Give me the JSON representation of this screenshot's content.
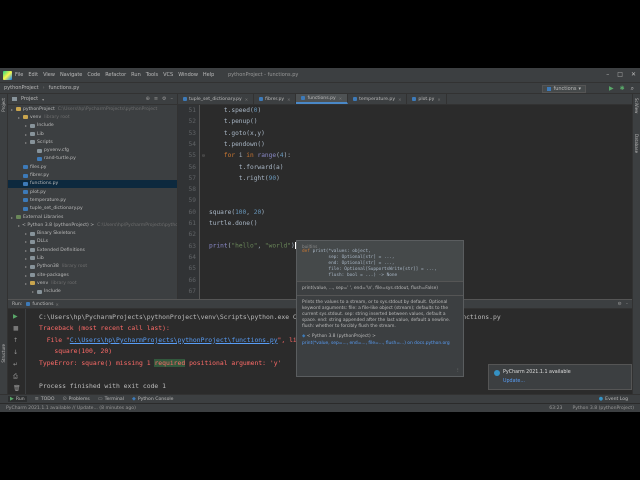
{
  "menubar": {
    "items": [
      "File",
      "Edit",
      "View",
      "Navigate",
      "Code",
      "Refactor",
      "Run",
      "Tools",
      "VCS",
      "Window",
      "Help"
    ],
    "window_title": "pythonProject - functions.py"
  },
  "navbar": {
    "crumbs": [
      "pythonProject",
      "functions.py"
    ],
    "run_config": "functions"
  },
  "project_panel": {
    "title": "Project",
    "tree": [
      {
        "label": "pythonProject",
        "hint": "C:\\Users\\hp\\PycharmProjects\\pythonProject",
        "depth": 0,
        "icon": "folder-y"
      },
      {
        "label": "venv",
        "hint": "library root",
        "depth": 1,
        "icon": "folder-y"
      },
      {
        "label": "Include",
        "hint": "",
        "depth": 2,
        "icon": "folder"
      },
      {
        "label": "Lib",
        "hint": "",
        "depth": 2,
        "icon": "folder"
      },
      {
        "label": "Scripts",
        "hint": "",
        "depth": 2,
        "icon": "folder"
      },
      {
        "label": "pyvenv.cfg",
        "hint": "",
        "depth": 3,
        "icon": "folder"
      },
      {
        "label": "rand-turtle.py",
        "hint": "",
        "depth": 3,
        "icon": "py"
      },
      {
        "label": "files.py",
        "hint": "",
        "depth": 1,
        "icon": "py"
      },
      {
        "label": "fibrer.py",
        "hint": "",
        "depth": 1,
        "icon": "py"
      },
      {
        "label": "functions.py",
        "hint": "",
        "depth": 1,
        "icon": "py"
      },
      {
        "label": "plot.py",
        "hint": "",
        "depth": 1,
        "icon": "py"
      },
      {
        "label": "temperature.py",
        "hint": "",
        "depth": 1,
        "icon": "py"
      },
      {
        "label": "tuple_set_dictionary.py",
        "hint": "",
        "depth": 1,
        "icon": "py"
      },
      {
        "label": "External Libraries",
        "hint": "",
        "depth": 0,
        "icon": "lib"
      },
      {
        "label": "< Python 3.8 (pythonProject) >",
        "hint": "C:\\Users\\hp\\PycharmProjects\\pytho",
        "depth": 1,
        "icon": "lib"
      },
      {
        "label": "Binary Skeletons",
        "hint": "",
        "depth": 2,
        "icon": "folder"
      },
      {
        "label": "DLLs",
        "hint": "",
        "depth": 2,
        "icon": "folder"
      },
      {
        "label": "Extended Definitions",
        "hint": "",
        "depth": 2,
        "icon": "folder"
      },
      {
        "label": "Lib",
        "hint": "",
        "depth": 2,
        "icon": "folder"
      },
      {
        "label": "Python38",
        "hint": "library root",
        "depth": 2,
        "icon": "folder"
      },
      {
        "label": "site-packages",
        "hint": "",
        "depth": 2,
        "icon": "folder"
      },
      {
        "label": "venv",
        "hint": "library root",
        "depth": 2,
        "icon": "folder-y"
      },
      {
        "label": "Include",
        "hint": "",
        "depth": 3,
        "icon": "folder"
      }
    ]
  },
  "editor_tabs": [
    {
      "label": "tuple_set_dictionary.py",
      "active": false
    },
    {
      "label": "fibrer.py",
      "active": false
    },
    {
      "label": "functions.py",
      "active": true
    },
    {
      "label": "temperature.py",
      "active": false
    },
    {
      "label": "plot.py",
      "active": false
    }
  ],
  "code_lines": [
    {
      "n": "51",
      "text": "    t.speed(0)"
    },
    {
      "n": "52",
      "text": "    t.penup()"
    },
    {
      "n": "53",
      "text": "    t.goto(x,y)"
    },
    {
      "n": "54",
      "text": "    t.pendown()"
    },
    {
      "n": "55",
      "text": "    for i in range(4):"
    },
    {
      "n": "56",
      "text": "        t.forward(a)"
    },
    {
      "n": "57",
      "text": "        t.right(90)"
    },
    {
      "n": "58",
      "text": ""
    },
    {
      "n": "59",
      "text": ""
    },
    {
      "n": "60",
      "text": "square(100, 20)"
    },
    {
      "n": "61",
      "text": "turtle.done()"
    },
    {
      "n": "62",
      "text": ""
    },
    {
      "n": "63",
      "text": "print(\"hello\", \"world\")"
    },
    {
      "n": "64",
      "text": ""
    },
    {
      "n": "65",
      "text": ""
    },
    {
      "n": "66",
      "text": ""
    },
    {
      "n": "67",
      "text": ""
    }
  ],
  "doc_popup": {
    "module": "builtins",
    "sig_lines": [
      "def print(*values: object,",
      "          sep: Optional[str] = ...,",
      "          end: Optional[str] = ...,",
      "          file: Optional[SupportsWrite[str]] = ...,",
      "          flush: bool = ...) -> None"
    ],
    "hint": "print(value, ..., sep=' ', end='\\n', file=sys.stdout, flush=False)",
    "body": [
      "Prints the values to a stream, or to sys.stdout by default. Optional",
      "keyword arguments: file: a file-like object (stream); defaults to the",
      "current sys.stdout. sep: string inserted between values, default a",
      "space. end: string appended after the last value, default a newline.",
      "flush: whether to forcibly flush the stream."
    ],
    "source": "< Python 3.8 (pythonProject) >",
    "link": "print(*value, sep=..., end=..., file=..., flush=...) on docs.python.org"
  },
  "run_panel": {
    "label": "Run:",
    "tab": "functions",
    "console": [
      {
        "type": "norm",
        "text": "C:\\Users\\hp\\PycharmProjects\\pythonProject\\venv\\Scripts\\python.exe C:/Users/hp/PycharmProjects/pythonProject/functions.py"
      },
      {
        "type": "err",
        "text": "Traceback (most recent call last):"
      },
      {
        "type": "file",
        "prefix": "  File \"",
        "link": "C:\\Users\\hp\\PycharmProjects\\pythonProject\\functions.py",
        "suffix": "\", line 60, in <module>"
      },
      {
        "type": "err",
        "text": "    square(100, 20)"
      },
      {
        "type": "typeerr",
        "before": "TypeError: square() missing 1 ",
        "hl": "required",
        "after": " positional argument: 'y'"
      },
      {
        "type": "norm",
        "text": ""
      },
      {
        "type": "norm",
        "text": "Process finished with exit code 1"
      }
    ]
  },
  "notification": {
    "title": "PyCharm 2021.1.1 available",
    "action": "Update..."
  },
  "bottom_tools": [
    "Run",
    "TODO",
    "Problems",
    "Terminal",
    "Python Console"
  ],
  "event_log": "Event Log",
  "statusbar": {
    "left": "PyCharm 2021.1.1 available // Update... (8 minutes ago)",
    "position": "63:23",
    "interpreter": "Python 3.8 (pythonProject)"
  },
  "colors": {
    "bg": "#2b2b2b",
    "panel": "#3c3f41",
    "keyword": "#cc7832",
    "number": "#6897bb",
    "string": "#6a8759",
    "error": "#ff6b68",
    "link": "#589df6"
  }
}
